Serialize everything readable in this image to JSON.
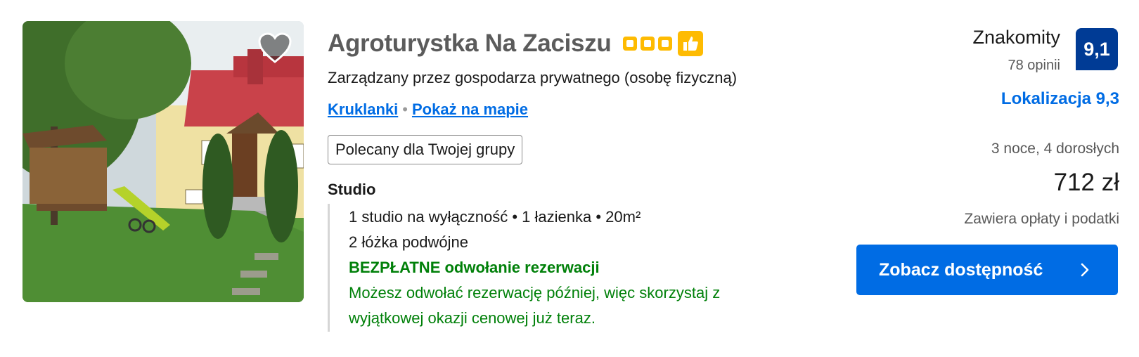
{
  "property": {
    "name": "Agroturystka Na Zaciszu",
    "star_count": 3,
    "managed_by": "Zarządzany przez gospodarza prywatnego (osobę fizyczną)",
    "location_link": "Kruklanki",
    "map_link": "Pokaż na mapie",
    "recommended_badge": "Polecany dla Twojej grupy",
    "icons": {
      "favorite": "heart-icon",
      "thumb": "thumbs-up-icon",
      "stars": "star-square-icon",
      "chevron": "chevron-right-icon"
    }
  },
  "room": {
    "type": "Studio",
    "details": "1 studio na wyłączność • 1 łazienka • 20m²",
    "beds": "2 łóżka podwójne",
    "free_cancellation": "BEZPŁATNE odwołanie rezerwacji",
    "cancellation_note_1": "Możesz odwołać rezerwację później, więc skorzystaj z",
    "cancellation_note_2": "wyjątkowej okazji cenowej już teraz."
  },
  "review": {
    "label": "Znakomity",
    "count": "78 opinii",
    "score": "9,1",
    "location_score": "Lokalizacja 9,3"
  },
  "pricing": {
    "stay": "3 noce, 4 dorosłych",
    "price": "712 zł",
    "taxes": "Zawiera opłaty i podatki",
    "cta": "Zobacz dostępność"
  },
  "colors": {
    "brand_blue": "#006ce4",
    "score_navy": "#003b95",
    "star_yellow": "#febb02",
    "green": "#008009"
  }
}
